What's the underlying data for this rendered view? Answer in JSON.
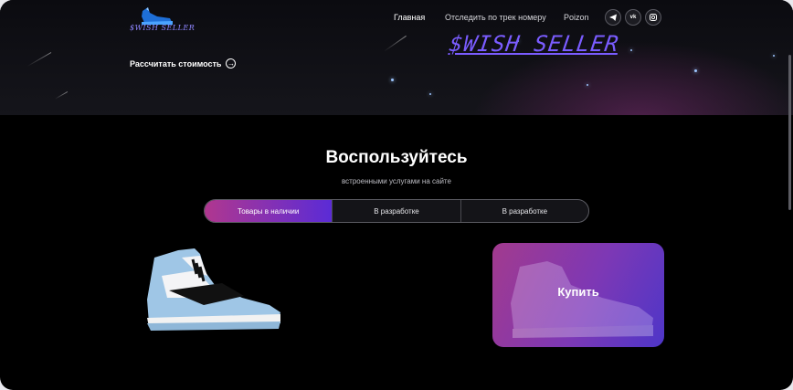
{
  "header": {
    "logo_text": "$WISH SELLER",
    "nav": [
      "Главная",
      "Отследить по трек номеру",
      "Poizon"
    ],
    "social_icons": [
      "telegram-icon",
      "vk-icon",
      "instagram-icon"
    ],
    "hero_title": "$WISH SELLER",
    "calc_label": "Рассчитать стоимость"
  },
  "services": {
    "title": "Воспользуйтесь",
    "subtitle": "встроенными услугами на сайте",
    "tabs": [
      "Товары в наличии",
      "В разработке",
      "В разработке"
    ],
    "active_tab": 0
  },
  "card": {
    "label": "Купить"
  },
  "colors": {
    "accent_start": "#b0378f",
    "accent_end": "#5b2bd6",
    "logo": "#7a5cff"
  }
}
